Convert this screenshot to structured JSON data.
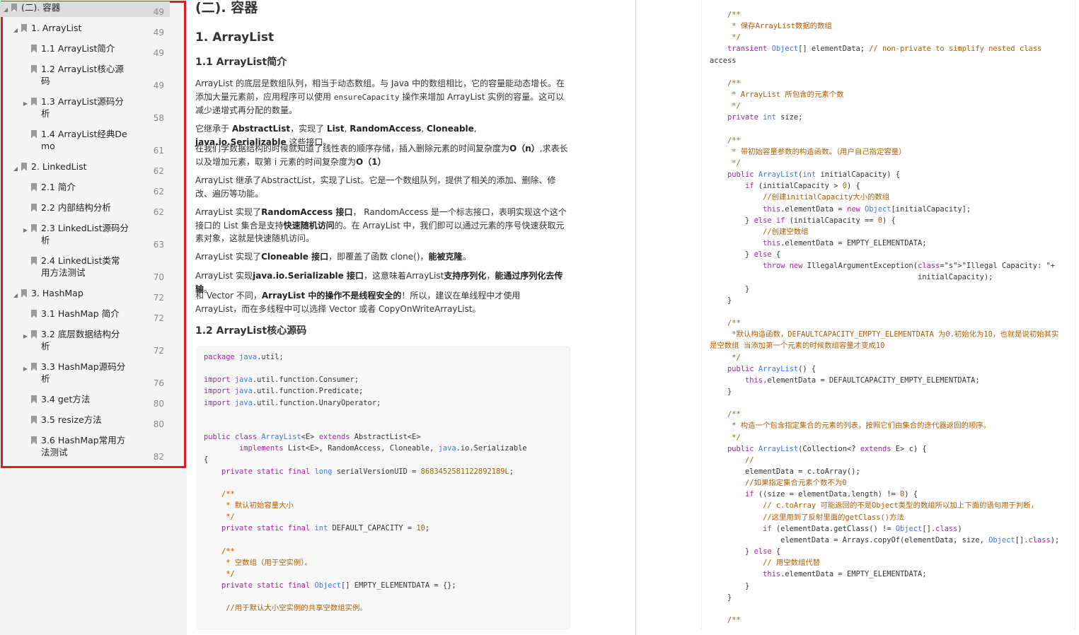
{
  "outline": {
    "items": [
      {
        "label": "(二). 容器",
        "page": "49"
      },
      {
        "label": "1. ArrayList",
        "page": "49"
      },
      {
        "label": "1.1 ArrayList简介",
        "page": "49"
      },
      {
        "label": "1.2 ArrayList核心源",
        "label2": "码",
        "page": "49"
      },
      {
        "label": "1.3 ArrayList源码分",
        "label2": "析",
        "page": "58"
      },
      {
        "label": "1.4  ArrayList经典De",
        "label2": "mo",
        "page": "61"
      },
      {
        "label": "2. LinkedList",
        "page": "62"
      },
      {
        "label": "2.1 简介",
        "page": "62"
      },
      {
        "label": "2.2 内部结构分析",
        "page": "62"
      },
      {
        "label": "2.3 LinkedList源码分",
        "label2": "析",
        "page": "63"
      },
      {
        "label": "2.4  LinkedList类常",
        "label2": "用方法测试",
        "page": "70"
      },
      {
        "label": "3. HashMap",
        "page": "72"
      },
      {
        "label": "3.1 HashMap 简介",
        "page": "72"
      },
      {
        "label": "3.2 底层数据结构分",
        "label2": "析",
        "page": "72"
      },
      {
        "label": "3.3 HashMap源码分",
        "label2": "析",
        "page": "76"
      },
      {
        "label": "3.4 get方法",
        "page": "80"
      },
      {
        "label": "3.5 resize方法",
        "page": "80"
      },
      {
        "label": "3.6 HashMap常用方",
        "label2": "法测试",
        "page": "82"
      }
    ]
  },
  "doc": {
    "h_container": "(二). 容器",
    "h_arraylist": "1. ArrayList",
    "h_intro": "1.1 ArrayList简介",
    "h_core": "1.2 ArrayList核心源码",
    "p1": {
      "a": "ArrayList 的底层是数组队列，相当于动态数组。与 Java 中的数组相比，它的容量能动态增长。在添加大量元素前，应用程序可以使用 ",
      "code": "ensureCapacity",
      "b": " 操作来增加 ArrayList 实例的容量。这可以减少递增式再分配的数量。"
    },
    "p2": {
      "a": "它继承于 ",
      "b1": "AbstractList",
      "c": "，实现了 ",
      "b2": "List",
      "d": ", ",
      "b3": "RandomAccess",
      "e": ", ",
      "b4": "Cloneable",
      "f": ", ",
      "b5": "java.io.Serializable",
      "g": " 这些接口。"
    },
    "p3": {
      "a": "在我们学数据结构的时候就知道了线性表的顺序存储，插入删除元素的时间复杂度为",
      "b1": "O（n）",
      "c": ",求表长以及增加元素，取第 i  元素的时间复杂度为",
      "b2": "O（1）"
    },
    "p4": " ArrayList 继承了AbstractList，实现了List。它是一个数组队列，提供了相关的添加、删除、修改、遍历等功能。",
    "p5": {
      "a": "      ArrayList 实现了",
      "b1": "RandomAccess 接口",
      "c": "， RandomAccess 是一个标志接口，表明实现这个这个接口的 List 集合是支持",
      "b2": "快速随机访问",
      "d": "的。在 ArrayList 中，我们即可以通过元素的序号快速获取元素对象，这就是快速随机访问。"
    },
    "p6": {
      "a": "ArrayList 实现了",
      "b1": "Cloneable 接口",
      "c": "，即覆盖了函数 clone()，",
      "b2": "能被克隆",
      "d": "。"
    },
    "p7": {
      "a": "      ArrayList 实现",
      "b1": "java.io.Serializable 接口",
      "c": "，这意味着ArrayList",
      "b2": "支持序列化",
      "d": "，",
      "b3": "能通过序列化去传输",
      "e": "。"
    },
    "p8": {
      "a": "      和 Vector 不同，",
      "b1": "ArrayList 中的操作不是线程安全的",
      "c": "！所以，建议在单线程中才使用 ArrayList，而在多线程中可以选择 Vector 或者  CopyOnWriteArrayList。"
    }
  },
  "code1": [
    "package java.util;",
    "",
    "import java.util.function.Consumer;",
    "import java.util.function.Predicate;",
    "import java.util.function.UnaryOperator;",
    "",
    "",
    "public class ArrayList<E> extends AbstractList<E>",
    "        implements List<E>, RandomAccess, Cloneable, java.io.Serializable",
    "{",
    "    private static final long serialVersionUID = 8683452581122892189L;",
    "",
    "    /**",
    "     * 默认初始容量大小",
    "     */",
    "    private static final int DEFAULT_CAPACITY = 10;",
    "",
    "    /**",
    "     * 空数组（用于空实例）。",
    "     */",
    "    private static final Object[] EMPTY_ELEMENTDATA = {};",
    "",
    "     //用于默认大小空实例的共享空数组实例。"
  ],
  "code2": [
    "    /**",
    "     * 保存ArrayList数据的数组",
    "     */",
    "    transient Object[] elementData; // non-private to simplify nested class",
    "access",
    "",
    "    /**",
    "     * ArrayList 所包含的元素个数",
    "     */",
    "    private int size;",
    "",
    "    /**",
    "     * 带初始容量参数的构造函数。（用户自己指定容量）",
    "     */",
    "    public ArrayList(int initialCapacity) {",
    "        if (initialCapacity > 0) {",
    "            //创建initialCapacity大小的数组",
    "            this.elementData = new Object[initialCapacity];",
    "        } else if (initialCapacity == 0) {",
    "            //创建空数组",
    "            this.elementData = EMPTY_ELEMENTDATA;",
    "        } else {",
    "            throw new IllegalArgumentException(\"Illegal Capacity: \"+",
    "                                               initialCapacity);",
    "        }",
    "    }",
    "",
    "    /**",
    "     *默认构造函数，DEFAULTCAPACITY_EMPTY_ELEMENTDATA 为0.初始化为10，也就是说初始其实",
    "是空数组 当添加第一个元素的时候数组容量才变成10",
    "     */",
    "    public ArrayList() {",
    "        this.elementData = DEFAULTCAPACITY_EMPTY_ELEMENTDATA;",
    "    }",
    "",
    "    /**",
    "     * 构造一个包含指定集合的元素的列表，按照它们由集合的迭代器返回的顺序。",
    "     */",
    "    public ArrayList(Collection<? extends E> c) {",
    "        //",
    "        elementData = c.toArray();",
    "        //如果指定集合元素个数不为0",
    "        if ((size = elementData.length) != 0) {",
    "            // c.toArray 可能返回的不是Object类型的数组所以加上下面的语句用于判断，",
    "            //这里用到了反射里面的getClass()方法",
    "            if (elementData.getClass() != Object[].class)",
    "                elementData = Arrays.copyOf(elementData, size, Object[].class);",
    "        } else {",
    "            // 用空数组代替",
    "            this.elementData = EMPTY_ELEMENTDATA;",
    "        }",
    "    }",
    "",
    "    /**"
  ]
}
